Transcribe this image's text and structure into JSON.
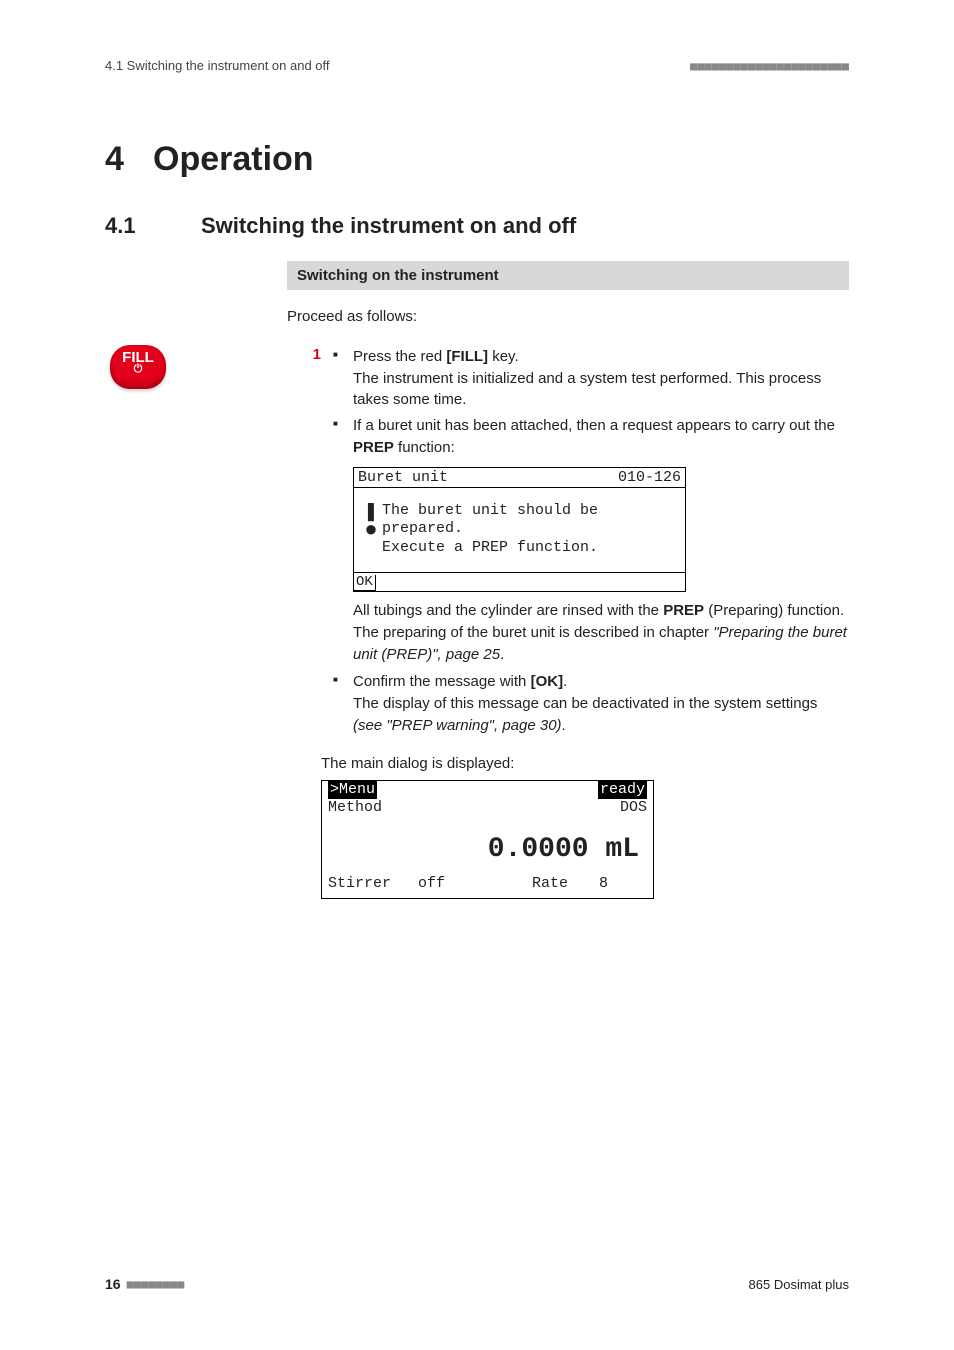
{
  "header": {
    "left": "4.1 Switching the instrument on and off",
    "right_ticks": "■■■■■■■■■■■■■■■■■■■■■■"
  },
  "footer": {
    "page_number": "16",
    "ticks": "■■■■■■■■",
    "product": "865 Dosimat plus"
  },
  "chapter": {
    "num": "4",
    "title": "Operation"
  },
  "section": {
    "num": "4.1",
    "title": "Switching the instrument on and off"
  },
  "subhead": "Switching on the instrument",
  "intro": "Proceed as follows:",
  "fill_badge": {
    "label": "FILL",
    "power_symbol": "⏻"
  },
  "step1": {
    "num": "1",
    "bullet1_pre": "Press the red ",
    "bullet1_key": "[FILL]",
    "bullet1_post": " key.",
    "bullet1_cont": "The instrument is initialized and a system test performed. This process takes some time.",
    "bullet2_pre": "If a buret unit has been attached, then a request appears to carry out the ",
    "bullet2_bold": "PREP",
    "bullet2_post": " function:",
    "lcd_buret": {
      "title": "Buret unit",
      "code": "010-126",
      "msg_line1": "The buret unit should be",
      "msg_line2": "prepared.",
      "msg_line3": "Execute a PREP function.",
      "ok": "OK"
    },
    "after_lcd_pre": "All tubings and the cylinder are rinsed with the ",
    "after_lcd_bold": "PREP",
    "after_lcd_mid": " (Preparing) function. The preparing of the buret unit is described in chapter ",
    "after_lcd_ref": "\"Preparing the buret unit (PREP)\", page 25",
    "after_lcd_end": ".",
    "bullet3_pre": "Confirm the message with ",
    "bullet3_key": "[OK]",
    "bullet3_post": ".",
    "bullet3_cont_pre": "The display of this message can be deactivated in the system set­tings ",
    "bullet3_cont_ref": "(see \"PREP warning\", page 30)",
    "bullet3_cont_end": ".",
    "main_dialog_intro": "The main dialog is displayed:",
    "lcd_main": {
      "menu": ">Menu",
      "ready": "ready",
      "method": "Method",
      "dos": "DOS",
      "value": "0.0000 mL",
      "stirrer_label": "Stirrer",
      "stirrer_val": "off",
      "rate_label": "Rate",
      "rate_val": "8"
    }
  }
}
